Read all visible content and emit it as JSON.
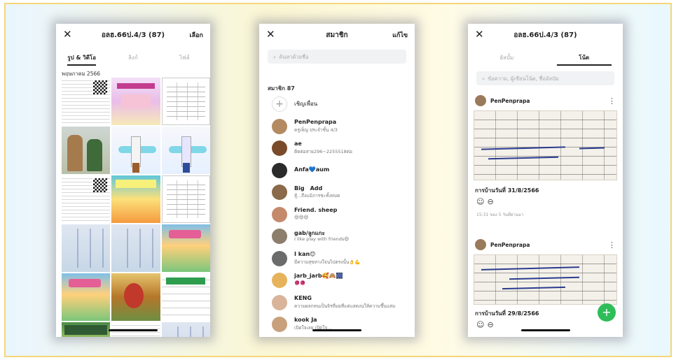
{
  "phone1": {
    "title": "อลฮ.66ป.4/3 (87)",
    "action": "เลือก",
    "tabs": [
      {
        "label": "รูป & วิดีโอ",
        "active": true
      },
      {
        "label": "ลิงก์",
        "active": false
      },
      {
        "label": "ไฟล์",
        "active": false
      }
    ],
    "month": "พฤษภาคม 2566"
  },
  "phone2": {
    "title": "สมาชิก",
    "action": "แก้ไข",
    "search_placeholder": "ค้นหาด้วยชื่อ",
    "members_count": "สมาชิก 87",
    "members": [
      {
        "name": "เชิญเพื่อน",
        "sub": "",
        "color": "#ffffff",
        "invite": true
      },
      {
        "name": "PenPenprapa",
        "sub": "ครูเพ็ญ ประจำชั้น 4/3",
        "color": "#b38a62"
      },
      {
        "name": "ae",
        "sub": "ติดต่อสาย296−2255518ต่อ",
        "color": "#7a4b2a"
      },
      {
        "name": "Anfa💙aum",
        "sub": "",
        "color": "#2b2b2b"
      },
      {
        "name": "Big　Add",
        "sub": "สู้...ถึงแม้ภารชะทั้งหมด",
        "color": "#8a6a4a"
      },
      {
        "name": "Friend. sheep",
        "sub": "😄😄😄",
        "color": "#c48a6b"
      },
      {
        "name": "gab/ลูกแกะ",
        "sub": "I like play with friends😄",
        "color": "#8c7d6c"
      },
      {
        "name": "I kan😊",
        "sub": "มีความสุขทางใจนไปตรงนั้น👌💪",
        "color": "#6b6b6b"
      },
      {
        "name": "jarb_jarb🥰🙈🎆",
        "sub": "🧶🧶",
        "color": "#e6b35c"
      },
      {
        "name": "KENG",
        "sub": "ความผลกหนเป็นจิรที่มยที่แด่แสดงนให้ความขึ้นแสม",
        "color": "#d9b49a"
      },
      {
        "name": "kook Ja",
        "sub": "เปิดใจเลย เปิดใจ...",
        "color": "#c9a07c"
      }
    ]
  },
  "phone3": {
    "title": "อลฮ.66ป.4/3 (87)",
    "tabs": [
      {
        "label": "อัลบั้ม",
        "active": false
      },
      {
        "label": "โน้ต",
        "active": true
      }
    ],
    "search_placeholder": "ข้อความ, ผู้เขียนโน้ต, ชื่ออัลบัม",
    "posts": [
      {
        "author": "PenPenprapa",
        "caption": "การบ้านวันที่ 31/8/2566",
        "time": "15:31 ของ 5 วันที่ผ่านมา"
      },
      {
        "author": "PenPenprapa",
        "caption": "การบ้านวันที่ 29/8/2566",
        "time": ""
      }
    ],
    "fab_label": "+"
  },
  "colors": {
    "accent_green": "#2ebd59",
    "frame_border": "#f3d67a"
  }
}
